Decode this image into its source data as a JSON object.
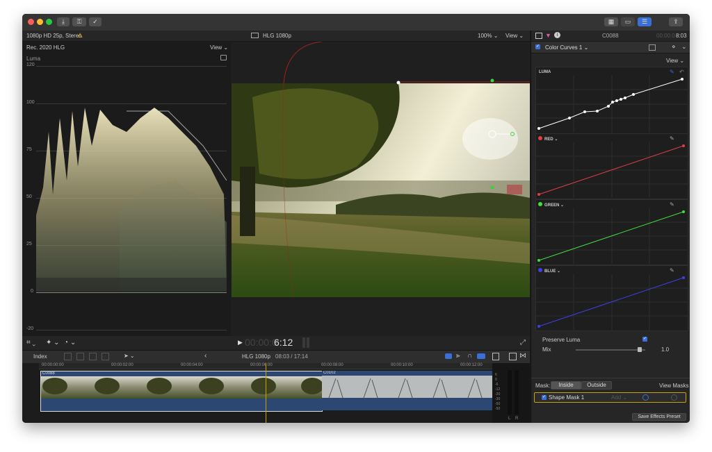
{
  "viewer": {
    "format": "1080p HD 25p, Stereo",
    "title": "HLG 1080p",
    "zoom": "100%",
    "view": "View"
  },
  "scope": {
    "mode": "Rec. 2020 HLG",
    "view": "View",
    "type": "Luma",
    "ticks": [
      "120",
      "100",
      "75",
      "50",
      "25",
      "0",
      "-20"
    ]
  },
  "playback": {
    "timecode_dim": "00:00:0",
    "timecode": "6:12"
  },
  "timeline_toolbar": {
    "index": "Index",
    "title": "HLG 1080p",
    "duration": "08:03 / 17:14"
  },
  "timeline": {
    "ruler": [
      "00:00:00:00",
      "00:00:02:00",
      "00:00:04:00",
      "00:00:06:00",
      "00:00:08:00",
      "00:00:10:00",
      "00:00:12:00"
    ],
    "clips": [
      "C0088",
      "C0102"
    ],
    "meter_ticks": [
      "6",
      "0",
      "-6",
      "-12",
      "-20",
      "-30",
      "-50",
      "-50"
    ],
    "meter_lr": [
      "L",
      "R"
    ]
  },
  "inspector": {
    "clip_name": "C0088",
    "timecode_dim": "00:00:0",
    "timecode": "8:03",
    "effect": "Color Curves 1",
    "view": "View",
    "curves": [
      "LUMA",
      "RED",
      "GREEN",
      "BLUE"
    ],
    "preserve_luma": "Preserve Luma",
    "mix_label": "Mix",
    "mix_value": "1.0",
    "mix_fraction": 0.92,
    "mask_label": "Mask:",
    "mask_inside": "Inside",
    "mask_outside": "Outside",
    "view_masks": "View Masks",
    "shape_mask": "Shape Mask 1",
    "add_label": "Add",
    "save_preset": "Save Effects Preset"
  },
  "colors": {
    "accent": "#3a6fd8",
    "red_curve": "#e04040",
    "green_curve": "#40e040",
    "blue_curve": "#4040e8",
    "clip_blue": "#2d4773",
    "mask_outline": "#c8a400"
  }
}
